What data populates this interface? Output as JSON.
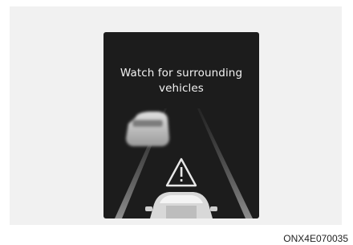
{
  "display": {
    "message_line1": "Watch for surrounding",
    "message_line2": "vehicles",
    "warning_icon": "warning-triangle-icon"
  },
  "figure_code": "ONX4E070035",
  "colors": {
    "screen_bg": "#1c1c1c",
    "panel_bg": "#f1f1f1",
    "text": "#f2f2f2"
  }
}
